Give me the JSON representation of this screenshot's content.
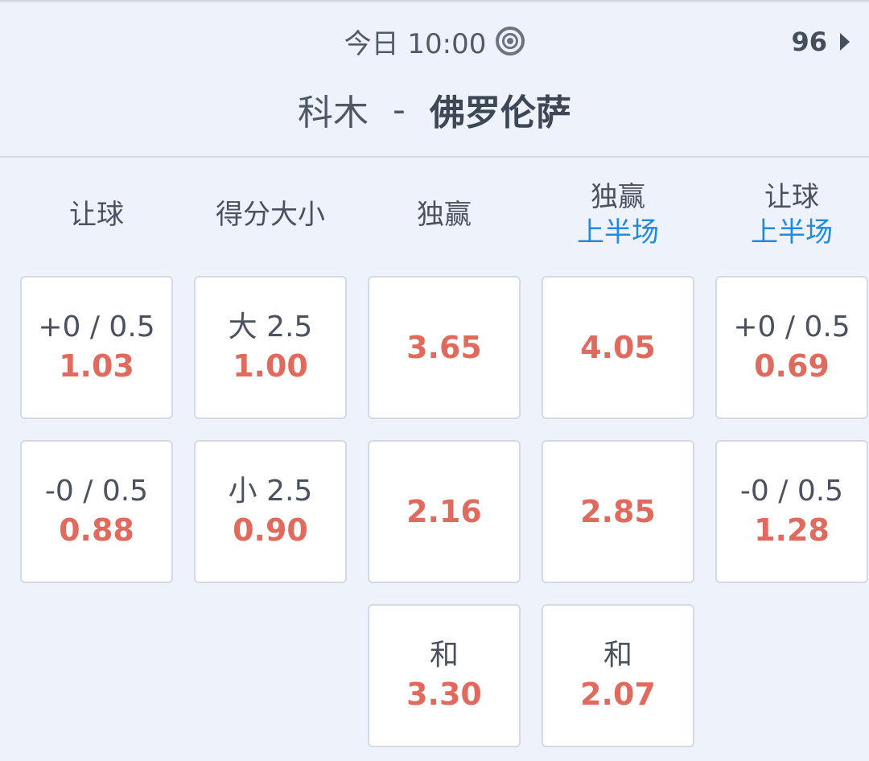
{
  "header": {
    "time": "今日 10:00",
    "more_count": "96",
    "home_team": "科木",
    "separator": "-",
    "away_team": "佛罗伦萨"
  },
  "columns": [
    {
      "title": "让球",
      "sub": ""
    },
    {
      "title": "得分大小",
      "sub": ""
    },
    {
      "title": "独赢",
      "sub": ""
    },
    {
      "title": "独赢",
      "sub": "上半场"
    },
    {
      "title": "让球",
      "sub": "上半场"
    }
  ],
  "rows": [
    [
      {
        "label": "+0 / 0.5",
        "odds": "1.03"
      },
      {
        "label": "大 2.5",
        "odds": "1.00"
      },
      {
        "label": "",
        "odds": "3.65"
      },
      {
        "label": "",
        "odds": "4.05"
      },
      {
        "label": "+0 / 0.5",
        "odds": "0.69"
      }
    ],
    [
      {
        "label": "-0 / 0.5",
        "odds": "0.88"
      },
      {
        "label": "小 2.5",
        "odds": "0.90"
      },
      {
        "label": "",
        "odds": "2.16"
      },
      {
        "label": "",
        "odds": "2.85"
      },
      {
        "label": "-0 / 0.5",
        "odds": "1.28"
      }
    ],
    [
      null,
      null,
      {
        "label": "和",
        "odds": "3.30"
      },
      {
        "label": "和",
        "odds": "2.07"
      },
      null
    ]
  ],
  "colors": {
    "odds": "#e06a5e",
    "subheader": "#1f8ae0",
    "background": "#eef2fb"
  }
}
